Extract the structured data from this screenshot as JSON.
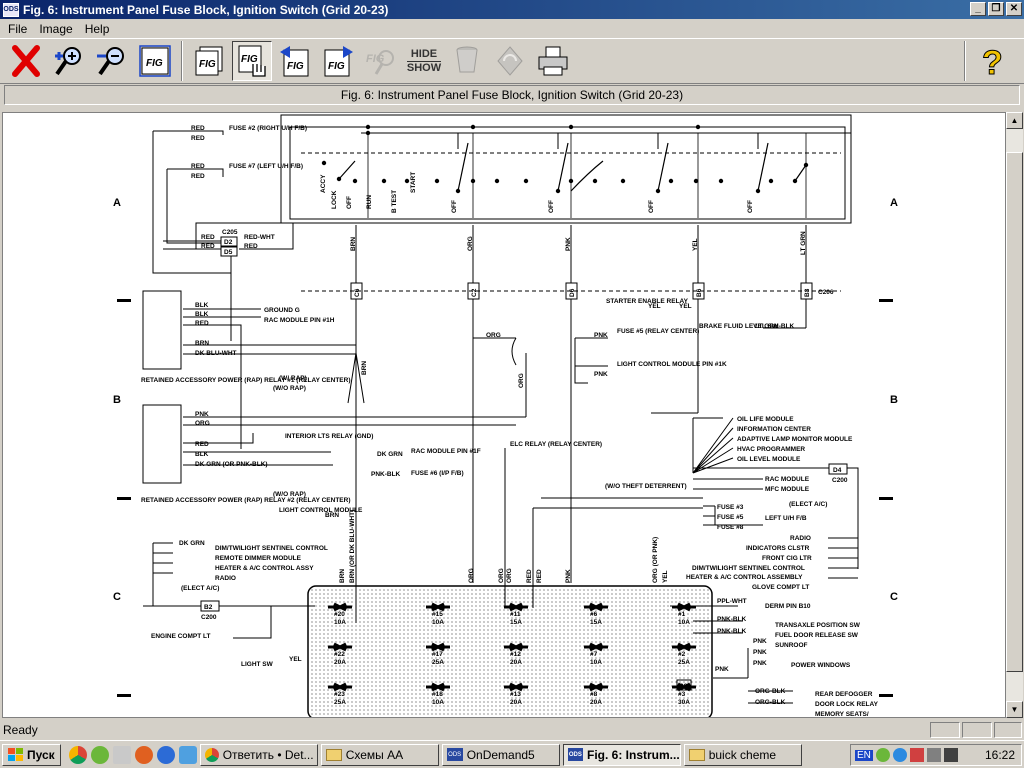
{
  "window": {
    "title": "Fig. 6: Instrument Panel Fuse Block, Ignition Switch (Grid 20-23)",
    "app_icon": "ODS"
  },
  "menu": {
    "items": [
      "File",
      "Image",
      "Help"
    ]
  },
  "toolbar": {
    "hide_show_top": "HIDE",
    "hide_show_bottom": "SHOW",
    "fig_label": "FIG"
  },
  "caption": "Fig. 6: Instrument Panel Fuse Block, Ignition Switch (Grid 20-23)",
  "diagram": {
    "grid_rows": [
      "A",
      "B",
      "C"
    ],
    "switch_positions": [
      "ACCY",
      "LOCK",
      "OFF",
      "RUN",
      "B TEST",
      "START",
      "OFF",
      "OFF",
      "OFF",
      "OFF"
    ],
    "wire_colors_top": [
      "BRN",
      "ORG",
      "PNK",
      "YEL",
      "LT GRN"
    ],
    "connectors_top": [
      "C6",
      "C2",
      "D6",
      "B6",
      "B3",
      "C206"
    ],
    "fuse_labels_left": [
      {
        "wire1": "RED",
        "wire2": "RED",
        "text": "FUSE #2 (RIGHT U/H F/B)"
      },
      {
        "wire1": "RED",
        "wire2": "RED",
        "text": "FUSE #7 (LEFT U/H F/B)"
      }
    ],
    "c205": {
      "label": "C205",
      "rows": [
        [
          "RED",
          "D2",
          "RED-WHT"
        ],
        [
          "RED",
          "D5",
          "RED"
        ]
      ]
    },
    "relay1": {
      "pins": [
        "BLK",
        "BLK",
        "RED",
        "BRN",
        "DK BLU-WHT"
      ],
      "targets": [
        "GROUND G",
        "RAC MODULE PIN #1H"
      ],
      "title": "RETAINED ACCESSORY POWER (RAP) RELAY #1 (RELAY CENTER)"
    },
    "relay2": {
      "pins": [
        "PNK",
        "ORG",
        "RED",
        "BLK",
        "DK GRN (OR PNK-BLK)"
      ],
      "title": "RETAINED ACCESSORY POWER (RAP) RELAY #2 (RELAY CENTER)"
    },
    "misc": {
      "w_rap": "(W/ RAP)",
      "wo_rap": "(W/O RAP)",
      "wo_rap2": "(W/O RAP)",
      "interior_lts": "INTERIOR LTS RELAY (GND)",
      "rac_module_f": "RAC MODULE PIN #1F",
      "rac_dk_grn": "DK GRN",
      "fuse6": "FUSE #6 (I/P F/B)",
      "pnk_blk": "PNK-BLK",
      "starter": "STARTER ENABLE RELAY",
      "yel": "YEL",
      "yel2": "YEL",
      "brake": "BRAKE FLUID LEVEL SW",
      "brake_wire": "LT GRN-BLK",
      "org_label": "ORG",
      "pnk_fuse5": "FUSE #5 (RELAY CENTER)",
      "pnk1": "PNK",
      "pnk2": "PNK",
      "light_ctrl": "LIGHT CONTROL MODULE PIN #1K",
      "elc": "ELC RELAY (RELAY CENTER)",
      "light_ctrl2": "LIGHT CONTROL MODULE",
      "brn": "BRN",
      "wo_theft": "(W/O THEFT DETERRENT)",
      "d4": "D4",
      "c200": "C200",
      "c200b": "C200",
      "elect_ac": "(ELECT A/C)",
      "elect_ac2": "(ELECT A/C)",
      "lh_fb": "LEFT U/H F/B",
      "b2": "B2",
      "engine_lt": "ENGINE COMPT LT",
      "light_sw": "LIGHT SW",
      "ppl_wht": "PPL-WHT",
      "derm": "DERM PIN B10",
      "trans": "TRANSAXLE POSITION SW",
      "fuel_door": "FUEL DOOR RELEASE SW",
      "sunroof": "SUNROOF",
      "power_windows": "POWER WINDOWS",
      "rear_defog": "REAR DEFOGGER",
      "door_lock": "DOOR LOCK RELAY",
      "memory": "MEMORY SEATS/",
      "c8": "C8",
      "brn_vert": "BRN",
      "brn_or": "BRN (OR DK BLU-WHT)",
      "org_v": "ORG",
      "org_v2": "ORG",
      "org_v3": "ORG",
      "red_v": "RED",
      "red_v2": "RED",
      "pnk_v": "PNK",
      "org_pnk": "ORG (OR PNK)",
      "yel_v": "YEL",
      "org_blk": "ORG-BLK",
      "org_blk2": "ORG-BLK",
      "pnk_blk_r": "PNK-BLK",
      "pnk_blk_r2": "PNK-BLK",
      "pnk_r": "PNK",
      "pnk_a": "PNK",
      "pnk_b": "PNK",
      "pnk_c": "PNK"
    },
    "org_modules": [
      "OIL LIFE MODULE",
      "INFORMATION CENTER",
      "ADAPTIVE LAMP MONITOR MODULE",
      "HVAC PROGRAMMER",
      "OIL LEVEL MODULE",
      "RAC MODULE",
      "MFC MODULE"
    ],
    "red_fuses": [
      "FUSE #3",
      "FUSE #5",
      "FUSE #8"
    ],
    "right_org": [
      "RADIO",
      "INDICATORS CLSTR",
      "FRONT CIG LTR",
      "DIM/TWILIGHT SENTINEL CONTROL",
      "GLOVE COMPT LT",
      "HEATER & A/C CONTROL ASSEMBLY"
    ],
    "left_dkgrn": [
      "DIM/TWILIGHT SENTINEL CONTROL",
      "REMOTE DIMMER MODULE",
      "HEATER & A/C CONTROL ASSY",
      "RADIO"
    ],
    "fuses": [
      {
        "num": "#20",
        "amp": "10A"
      },
      {
        "num": "#15",
        "amp": "10A"
      },
      {
        "num": "#11",
        "amp": "15A"
      },
      {
        "num": "#6",
        "amp": "15A"
      },
      {
        "num": "#1",
        "amp": "10A"
      },
      {
        "num": "#22",
        "amp": "20A"
      },
      {
        "num": "#17",
        "amp": "25A"
      },
      {
        "num": "#12",
        "amp": "20A"
      },
      {
        "num": "#7",
        "amp": "10A"
      },
      {
        "num": "#2",
        "amp": "25A"
      },
      {
        "num": "#23",
        "amp": "25A"
      },
      {
        "num": "#18",
        "amp": "10A"
      },
      {
        "num": "#13",
        "amp": "20A"
      },
      {
        "num": "#8",
        "amp": "20A"
      },
      {
        "num": "#3",
        "amp": "30A"
      }
    ]
  },
  "status": {
    "text": "Ready"
  },
  "taskbar": {
    "start": "Пуск",
    "tasks": [
      "Ответить • Det...",
      "Схемы АА",
      "OnDemand5",
      "Fig. 6: Instrum...",
      "buick cheme"
    ],
    "active_index": 3,
    "lang": "EN",
    "clock": "16:22"
  }
}
